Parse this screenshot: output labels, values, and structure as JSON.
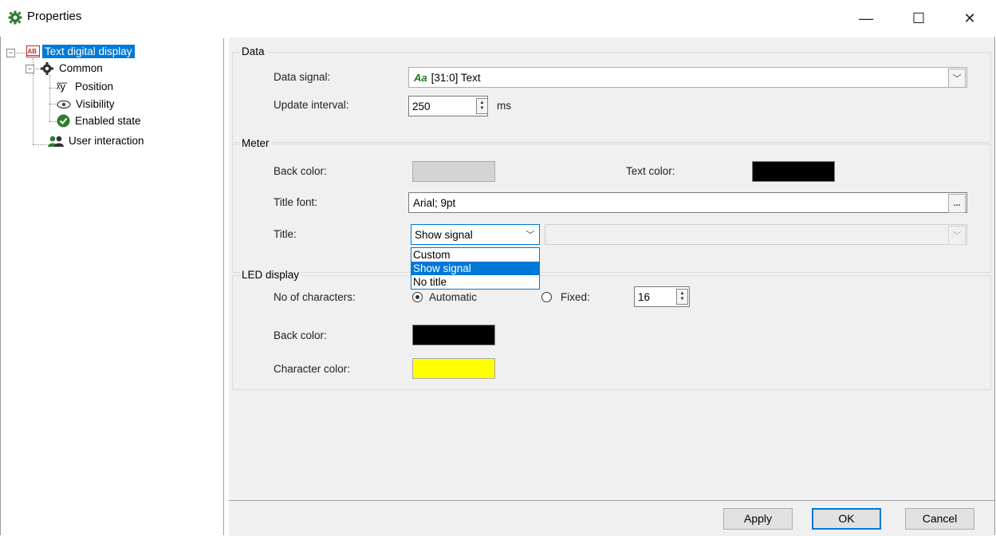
{
  "window": {
    "title": "Properties",
    "minimize": "—",
    "maximize": "☐",
    "close": "✕"
  },
  "tree": {
    "root": {
      "label": "Text digital display",
      "icon": "text-display-icon"
    },
    "common": {
      "label": "Common",
      "icon": "gear-icon"
    },
    "position": {
      "label": "Position",
      "icon": "xy-position-icon"
    },
    "visibility": {
      "label": "Visibility",
      "icon": "eye-icon"
    },
    "enabled": {
      "label": "Enabled state",
      "icon": "check-circle-icon"
    },
    "user_interaction": {
      "label": "User interaction",
      "icon": "users-icon"
    }
  },
  "data_group": {
    "title": "Data",
    "data_signal_label": "Data signal:",
    "data_signal_icon": "Aa",
    "data_signal_value": "[31:0] Text",
    "update_interval_label": "Update interval:",
    "update_interval_value": "250",
    "update_interval_unit": "ms"
  },
  "meter_group": {
    "title": "Meter",
    "back_color_label": "Back color:",
    "back_color": "#d4d4d4",
    "text_color_label": "Text color:",
    "text_color": "#000000",
    "title_font_label": "Title font:",
    "title_font_value": "Arial; 9pt",
    "title_font_button": "...",
    "title_label": "Title:",
    "title_value": "Show signal",
    "title_options": [
      "Custom",
      "Show signal",
      "No title"
    ],
    "title_selected_index": 1
  },
  "led_group": {
    "title": "LED display",
    "chars_label": "No of characters:",
    "automatic_label": "Automatic",
    "fixed_label": "Fixed:",
    "fixed_value": "16",
    "back_color_label": "Back color:",
    "back_color": "#000000",
    "char_color_label": "Character color:",
    "char_color": "#ffff00"
  },
  "footer": {
    "apply": "Apply",
    "ok": "OK",
    "cancel": "Cancel"
  },
  "colors": {
    "accent": "#0078d7",
    "signal_icon": "#1a7a1a"
  }
}
